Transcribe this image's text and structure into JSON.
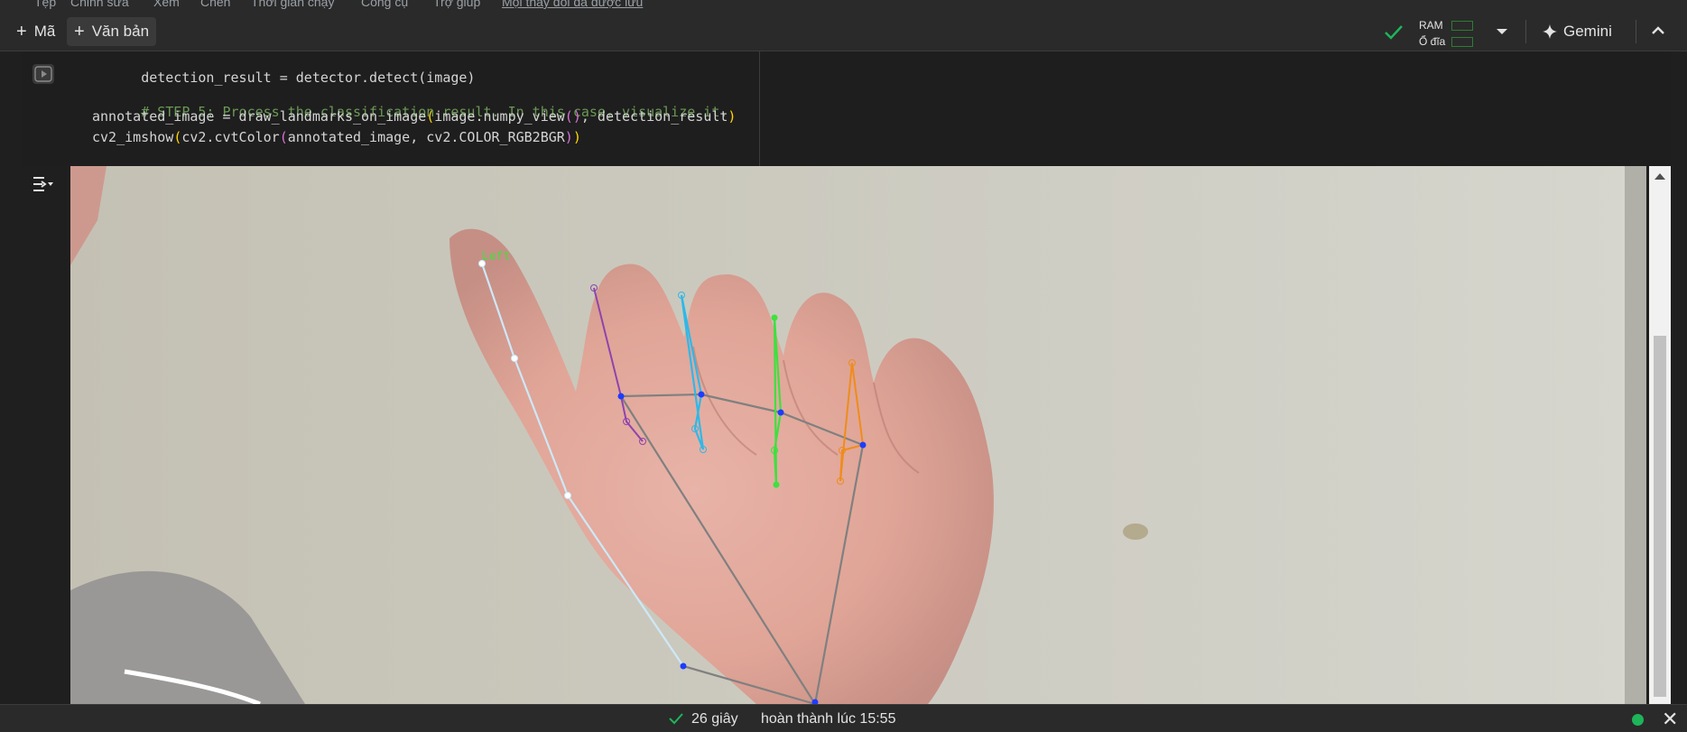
{
  "menubar": {
    "items": [
      "Tệp",
      "Chỉnh sửa",
      "Xem",
      "Chèn",
      "Thời gian chạy",
      "Công cụ",
      "Trợ giúp",
      "Mọi thay đổi đã được lưu"
    ]
  },
  "toolbar": {
    "add_code_label": "Mã",
    "add_text_label": "Văn bản",
    "ram_label": "RAM",
    "disk_label": "Ổ đĩa",
    "gemini_label": "Gemini",
    "status_color": "#1eb45a"
  },
  "code_cell": {
    "line1": "detection_result = detector.detect(image)",
    "comment": "# STEP 5: Process the classification result. In this case, visualize it.",
    "line3_a": "annotated_image = draw_landmarks_on_image",
    "line3_b": "image.numpy_view",
    "line3_c": ", detection_result",
    "line4_a": "cv2_imshow",
    "line4_b": "cv2.cvtColor",
    "line4_c": "annotated_image, cv2.COLOR_RGB2BGR"
  },
  "output": {
    "handedness_label": "Left",
    "landmark_colors": {
      "thumb": "#cde8f8",
      "index": "#8e44ad",
      "middle": "#2fb8e8",
      "ring": "#3fe03f",
      "pinky": "#ef8c1a",
      "palm": "#808080",
      "joint": "#1e3cff"
    }
  },
  "statusbar": {
    "duration": "26 giây",
    "completed_text": "hoàn thành lúc 15:55"
  }
}
